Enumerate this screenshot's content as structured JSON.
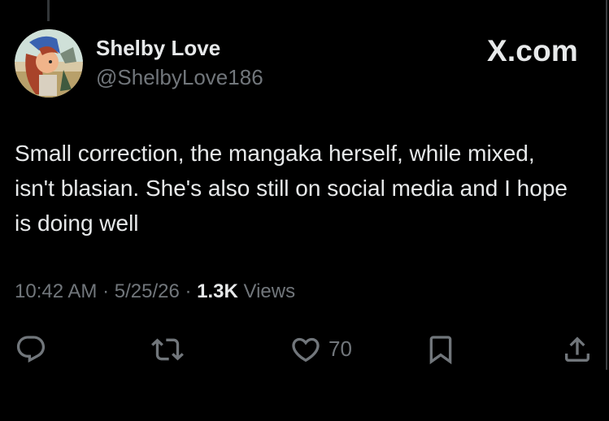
{
  "tweet": {
    "author_name": "Shelby Love",
    "author_handle": "@ShelbyLove186",
    "brand_label": "X.com",
    "text": "Small correction, the mangaka herself, while mixed, isn't blasian. She's also still on social media and I hope is doing well",
    "time": "10:42 AM",
    "date": "5/25/26",
    "separator": " · ",
    "views_count": "1.3K",
    "views_label": " Views",
    "like_count": "70"
  },
  "icons": {
    "reply": "reply-icon",
    "retweet": "retweet-icon",
    "like": "heart-icon",
    "bookmark": "bookmark-icon",
    "share": "share-icon"
  },
  "colors": {
    "background": "#000000",
    "primary_text": "#e7e9ea",
    "secondary_text": "#71767b"
  }
}
